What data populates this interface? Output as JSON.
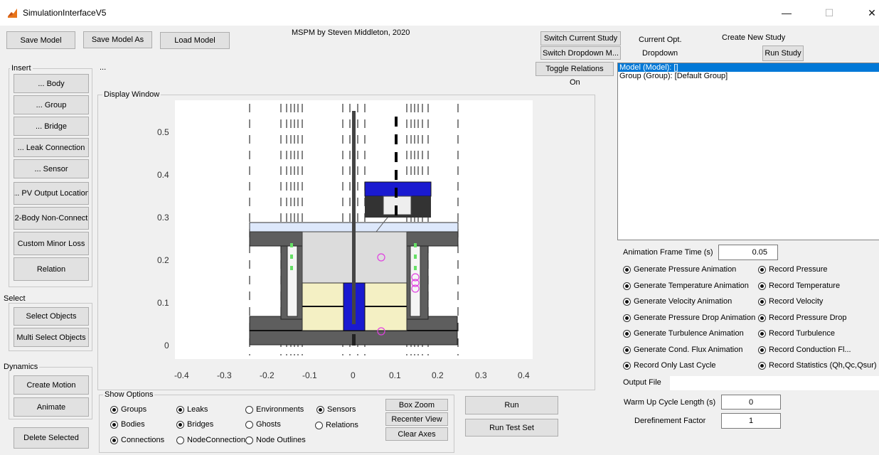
{
  "window": {
    "title": "SimulationInterfaceV5",
    "minimize": "—",
    "maximize": "☐",
    "close": "✕"
  },
  "header": {
    "credit": "MSPM by Steven Middleton, 2020",
    "insert_ellipsis": "..."
  },
  "toolbar": {
    "save_model": "Save Model",
    "save_model_as": "Save Model As",
    "load_model": "Load Model"
  },
  "study": {
    "switch_current": "Switch Current Study",
    "switch_dropdown": "Switch Dropdown M...",
    "toggle_relations": "Toggle Relations",
    "relations_state": "On",
    "current_opt": "Current Opt.",
    "dropdown": "Dropdown",
    "create_new": "Create New Study",
    "run_study": "Run Study"
  },
  "tree": {
    "items": [
      "Model (Model): []",
      "Group (Group): [Default Group]"
    ],
    "selected_index": 0
  },
  "insert": {
    "title": "Insert",
    "buttons": [
      "... Body",
      "... Group",
      "... Bridge",
      "... Leak Connection",
      "... Sensor",
      "... PV Output Location",
      "2-Body Non-Connect",
      "Custom Minor Loss",
      "Relation"
    ]
  },
  "select": {
    "title": "Select",
    "buttons": [
      "Select Objects",
      "Multi Select Objects"
    ]
  },
  "dynamics": {
    "title": "Dynamics",
    "buttons": [
      "Create Motion",
      "Animate"
    ]
  },
  "delete_selected": "Delete Selected",
  "display": {
    "title": "Display Window",
    "xticks": [
      "-0.4",
      "-0.3",
      "-0.2",
      "-0.1",
      "0",
      "0.1",
      "0.2",
      "0.3",
      "0.4"
    ],
    "yticks": [
      "0.5",
      "0.4",
      "0.3",
      "0.2",
      "0.1",
      "0"
    ],
    "xlim": [
      -0.42,
      0.42
    ],
    "ylim": [
      -0.03,
      0.56
    ]
  },
  "show_options": {
    "title": "Show Options",
    "items": [
      {
        "label": "Groups",
        "checked": true
      },
      {
        "label": "Leaks",
        "checked": true
      },
      {
        "label": "Environments",
        "checked": false
      },
      {
        "label": "Sensors",
        "checked": true
      },
      {
        "label": "Bodies",
        "checked": true
      },
      {
        "label": "Bridges",
        "checked": true
      },
      {
        "label": "Ghosts",
        "checked": false
      },
      {
        "label": "Relations",
        "checked": false
      },
      {
        "label": "Connections",
        "checked": true
      },
      {
        "label": "NodeConnections",
        "checked": false
      },
      {
        "label": "Node Outlines",
        "checked": false
      }
    ]
  },
  "view": {
    "box_zoom": "Box Zoom",
    "recenter": "Recenter View",
    "clear_axes": "Clear Axes"
  },
  "run": {
    "run": "Run",
    "run_test_set": "Run Test Set"
  },
  "animation": {
    "frame_time_label": "Animation Frame Time (s)",
    "frame_time_value": "0.05",
    "options": [
      {
        "label": "Generate Pressure Animation",
        "checked": true
      },
      {
        "label": "Record Pressure",
        "checked": true
      },
      {
        "label": "Generate Temperature Animation",
        "checked": true
      },
      {
        "label": "Record Temperature",
        "checked": true
      },
      {
        "label": "Generate Velocity Animation",
        "checked": true
      },
      {
        "label": "Record Velocity",
        "checked": true
      },
      {
        "label": "Generate Pressure Drop Animation",
        "checked": true
      },
      {
        "label": "Record Pressure Drop",
        "checked": true
      },
      {
        "label": "Generate Turbulence Animation",
        "checked": true
      },
      {
        "label": "Record Turbulence",
        "checked": true
      },
      {
        "label": "Generate Cond. Flux Animation",
        "checked": true
      },
      {
        "label": "Record Conduction Fl...",
        "checked": true
      },
      {
        "label": "Record Only Last Cycle",
        "checked": true
      },
      {
        "label": "Record Statistics (Qh,Qc,Qsur)",
        "checked": true
      }
    ],
    "output_file_label": "Output File",
    "output_file_value": "",
    "warmup_label": "Warm Up Cycle Length (s)",
    "warmup_value": "0",
    "derefinement_label": "Derefinement Factor",
    "derefinement_value": "1"
  },
  "colors": {
    "selection": "#0078d7",
    "body_dark": "#5a5a5a",
    "body_light": "#dddddd",
    "cream": "#f4f0c4",
    "blue": "#1a1ad0",
    "sensor": "#e040e0",
    "bridge": "#66e066",
    "matlab_orange": "#e8741a"
  }
}
